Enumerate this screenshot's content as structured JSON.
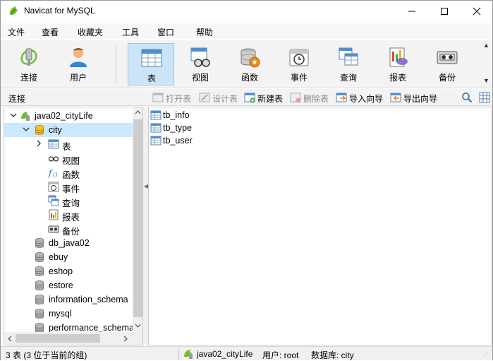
{
  "window": {
    "title": "Navicat for MySQL"
  },
  "menu": [
    "文件",
    "查看",
    "收藏夹",
    "工具",
    "窗口",
    "帮助"
  ],
  "toolbar": {
    "buttons": [
      {
        "label": "连接",
        "icon": "connection-icon"
      },
      {
        "label": "用户",
        "icon": "user-icon"
      },
      {
        "label": "表",
        "icon": "table-icon",
        "active": true
      },
      {
        "label": "视图",
        "icon": "view-icon"
      },
      {
        "label": "函数",
        "icon": "function-icon"
      },
      {
        "label": "事件",
        "icon": "event-icon"
      },
      {
        "label": "查询",
        "icon": "query-icon"
      },
      {
        "label": "报表",
        "icon": "report-icon"
      },
      {
        "label": "备份",
        "icon": "backup-icon"
      }
    ]
  },
  "subbar": {
    "connection_label": "连接",
    "actions": [
      {
        "label": "打开表",
        "enabled": false
      },
      {
        "label": "设计表",
        "enabled": false
      },
      {
        "label": "新建表",
        "enabled": true
      },
      {
        "label": "删除表",
        "enabled": false
      },
      {
        "label": "导入向导",
        "enabled": true
      },
      {
        "label": "导出向导",
        "enabled": true
      }
    ]
  },
  "tree": {
    "connection": "java02_cityLife",
    "selected_db": "city",
    "objects": [
      "表",
      "视图",
      "函数",
      "事件",
      "查询",
      "报表",
      "备份"
    ],
    "databases": [
      "db_java02",
      "ebuy",
      "eshop",
      "estore",
      "information_schema",
      "mysql",
      "performance_schema"
    ]
  },
  "tables": [
    "tb_info",
    "tb_type",
    "tb_user"
  ],
  "status": {
    "count_text": "3 表 (3 位于当前的组)",
    "connection": "java02_cityLife",
    "user": "用户: root",
    "database": "数据库: city"
  },
  "colors": {
    "accent": "#cce4f7",
    "selection": "#cce8ff",
    "db_icon": "#8a8a8a",
    "db_icon_active": "#f0c030"
  }
}
